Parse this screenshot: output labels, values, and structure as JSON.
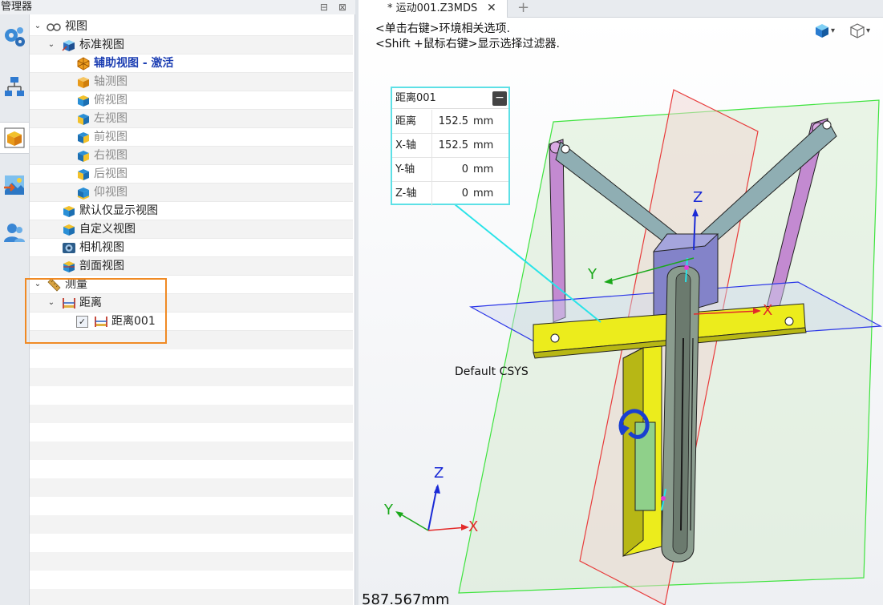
{
  "manager": {
    "title": "管理器",
    "restore_glyph": "⊟",
    "close_glyph": "⊠",
    "sidetabs": [
      {
        "icon": "gears-icon"
      },
      {
        "icon": "hierarchy-icon"
      },
      {
        "icon": "view-cube-icon",
        "active": true
      },
      {
        "icon": "landscape-icon"
      },
      {
        "icon": "user-icon"
      }
    ],
    "tree": {
      "view_root": "视图",
      "standard_views": "标准视图",
      "aux_view_active": "辅助视图 - 激活",
      "isometric": "轴测图",
      "top": "俯视图",
      "left": "左视图",
      "front": "前视图",
      "right": "右视图",
      "back": "后视图",
      "bottom": "仰视图",
      "default_display": "默认仅显示视图",
      "custom_view": "自定义视图",
      "camera_view": "相机视图",
      "section_view": "剖面视图",
      "measure": "测量",
      "distance": "距离",
      "distance_item": "距离001",
      "distance_item_checked": true
    }
  },
  "tabs": {
    "active_doc": "* 运动001.Z3MDS",
    "close_glyph": "✕",
    "new_glyph": "+"
  },
  "viewport": {
    "hint_line1": "<单击右键>环境相关选项.",
    "hint_line2": "<Shift +鼠标右键>显示选择过滤器.",
    "csys_label": "Default CSYS",
    "coord_readout": "587.567mm",
    "axis_labels": {
      "x": "X",
      "y": "Y",
      "z": "Z"
    },
    "toolbar": [
      {
        "icon": "shaded-cube-icon",
        "dropdown": "▾"
      },
      {
        "icon": "wireframe-cube-icon",
        "dropdown": "▾"
      }
    ],
    "colors": {
      "plane_xy": "#2a35e8",
      "plane_yz": "#e83a3a",
      "plane_xz": "#3ee33e",
      "yellow_part": "#ecec1c",
      "link_part": "#7f9fa3",
      "arm_part": "#c38ad1",
      "slot_part": "#6b7a6e",
      "block_part": "#8383c9",
      "leader_line": "#29e3e8"
    }
  },
  "measure_panel": {
    "title": "距离001",
    "collapse_glyph": "−",
    "rows": [
      {
        "label": "距离",
        "value": "152.5",
        "unit": "mm"
      },
      {
        "label": "X-轴",
        "value": "152.5",
        "unit": "mm"
      },
      {
        "label": "Y-轴",
        "value": "0",
        "unit": "mm"
      },
      {
        "label": "Z-轴",
        "value": "0",
        "unit": "mm"
      }
    ]
  }
}
